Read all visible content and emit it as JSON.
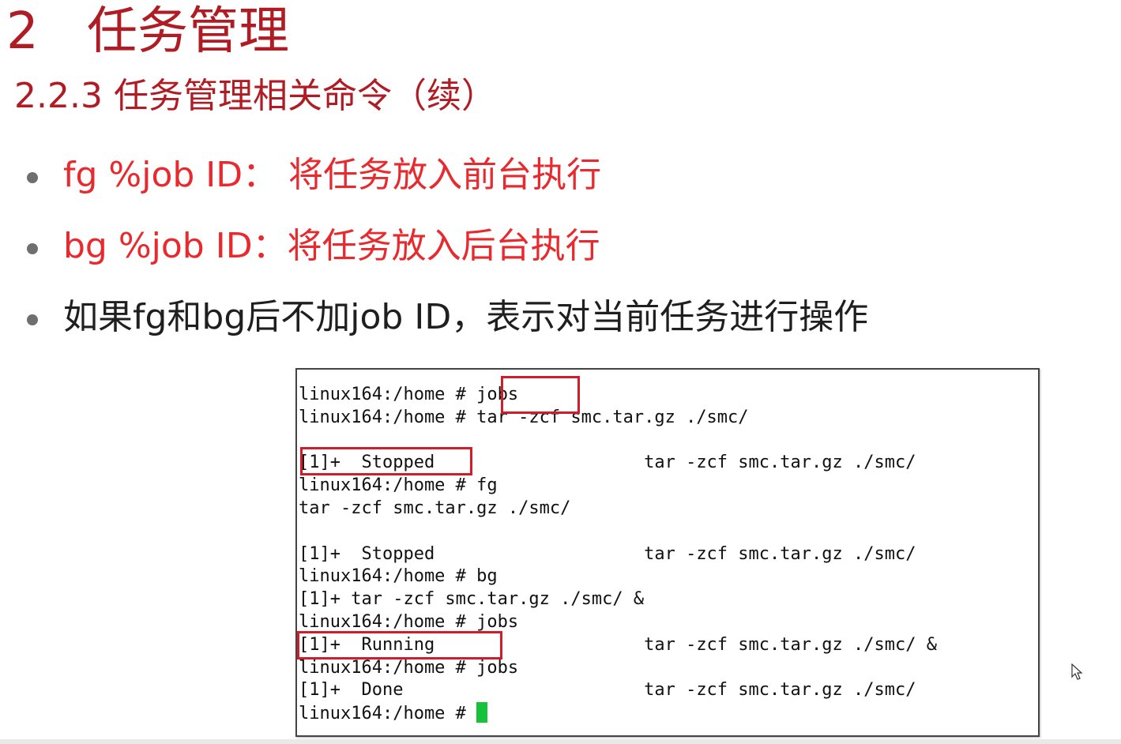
{
  "slide": {
    "title_number": "2",
    "title_text": "任务管理",
    "subtitle": "2.2.3 任务管理相关命令（续）",
    "bullets": [
      {
        "text": "fg %job ID： 将任务放入前台执行",
        "color": "#e8292d"
      },
      {
        "text": "bg %job ID：将任务放入后台执行",
        "color": "#e8292d"
      },
      {
        "text": "如果fg和bg后不加job ID，表示对当前任务进行操作",
        "color": "#1f1f1f"
      }
    ]
  },
  "terminal": {
    "lines": [
      "linux164:/home # jobs",
      "linux164:/home # tar -zcf smc.tar.gz ./smc/",
      "",
      "[1]+  Stopped                    tar -zcf smc.tar.gz ./smc/",
      "linux164:/home # fg",
      "tar -zcf smc.tar.gz ./smc/",
      "",
      "[1]+  Stopped                    tar -zcf smc.tar.gz ./smc/",
      "linux164:/home # bg",
      "[1]+ tar -zcf smc.tar.gz ./smc/ &",
      "linux164:/home # jobs",
      "[1]+  Running                    tar -zcf smc.tar.gz ./smc/ &",
      "linux164:/home # jobs",
      "[1]+  Done                       tar -zcf smc.tar.gz ./smc/",
      "linux164:/home # "
    ],
    "highlight_color": "#d11d2a",
    "cursor_color": "#16c23a"
  }
}
